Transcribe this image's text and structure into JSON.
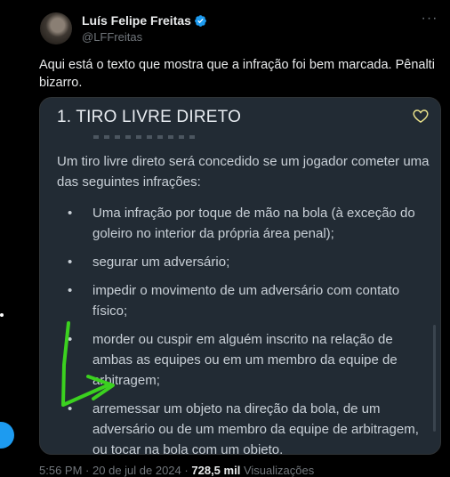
{
  "tweet": {
    "author_name": "Luís Felipe Freitas",
    "author_handle": "@LFFreitas",
    "text": "Aqui está o texto que mostra que a infração foi bem marcada. Pênalti bizarro.",
    "more_label": "···"
  },
  "image": {
    "title": "1. TIRO LIVRE DIRETO",
    "intro": "Um tiro livre direto será concedido se um jogador cometer uma das seguintes infrações:",
    "items": [
      "Uma infração por toque de mão na bola (à exceção do goleiro no interior da própria área penal);",
      "segurar um adversário;",
      "impedir o movimento de um adversário com contato físico;",
      "morder ou cuspir em alguém inscrito na relação de ambas as equipes ou em um membro da equipe de arbitragem;",
      "arremessar um objeto na direção da bola, de um adversário ou de um membro da equipe de arbitragem, ou tocar na bola com um objeto."
    ],
    "bullet": "•"
  },
  "meta": {
    "time": "5:56 PM",
    "date": "20 de jul de 2024",
    "separator": "·",
    "views_count": "728,5 mil",
    "views_label": "Visualizações"
  },
  "colors": {
    "accent": "#1d9bf0",
    "highlight": "#3bd11f",
    "heart": "#e8e08a"
  },
  "icons": [
    "verified-badge-icon",
    "more-options-icon",
    "heart-outline-icon",
    "green-arrow-annotation"
  ]
}
